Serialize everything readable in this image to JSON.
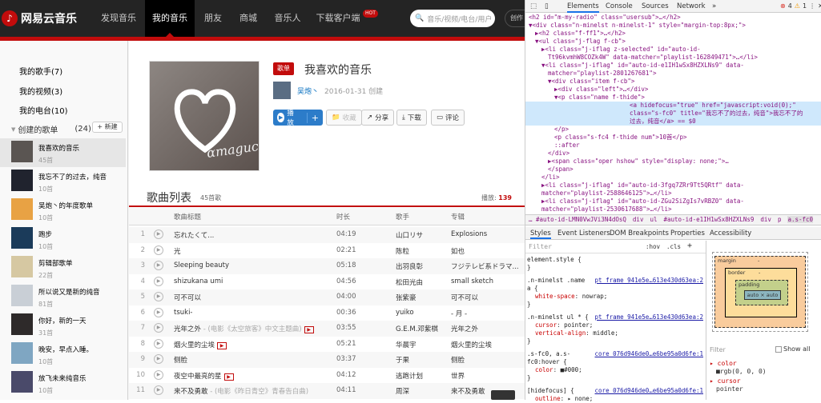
{
  "site": {
    "logo_text": "网易云音乐",
    "nav": [
      "发现音乐",
      "我的音乐",
      "朋友",
      "商城",
      "音乐人",
      "下载客户端"
    ],
    "hot_badge": "HOT",
    "search_placeholder": "音乐/视频/电台/用户",
    "creator_center": "创作"
  },
  "sidebar": {
    "top_items": [
      "我的歌手(7)",
      "我的视频(3)",
      "我的电台(10)"
    ],
    "created_label": "创建的歌单",
    "created_count": "(24)",
    "new_button": "+ 新建",
    "playlists": [
      {
        "name": "我喜欢的音乐",
        "count": "45首"
      },
      {
        "name": "我忘不了的过去，纯音",
        "count": "10首"
      },
      {
        "name": "吴炮丶的年度歌单",
        "count": "10首"
      },
      {
        "name": "跑步",
        "count": "10首"
      },
      {
        "name": "剪辑部歌单",
        "count": "22首"
      },
      {
        "name": "所以说又是新的纯音",
        "count": "81首"
      },
      {
        "name": "你好，新的一天",
        "count": "31首"
      },
      {
        "name": "晚安，早点入睡。",
        "count": "10首"
      },
      {
        "name": "放飞未来纯音乐",
        "count": "10首"
      }
    ]
  },
  "playlist": {
    "badge": "歌单",
    "title": "我喜欢的音乐",
    "creator": "吴炮丶",
    "created": "2016-01-31 创建",
    "buttons": {
      "play": "播放",
      "collect": "收藏",
      "share": "分享",
      "download": "下载",
      "comment": "评论"
    },
    "list_title": "歌曲列表",
    "list_count": "45首歌",
    "play_count_label": "播放:",
    "play_count": "139",
    "columns": [
      "歌曲标题",
      "时长",
      "歌手",
      "专辑"
    ],
    "songs": [
      {
        "no": "1",
        "title": "忘れたくて...",
        "alias": "",
        "mv": false,
        "duration": "04:19",
        "singer": "山口リサ",
        "album": "Explosions"
      },
      {
        "no": "2",
        "title": "光",
        "alias": "",
        "mv": false,
        "duration": "02:21",
        "singer": "陈粒",
        "album": "如也"
      },
      {
        "no": "3",
        "title": "Sleeping beauty",
        "alias": "",
        "mv": false,
        "duration": "05:18",
        "singer": "出羽良彰",
        "album": "フジテレビ系ドラマ..."
      },
      {
        "no": "4",
        "title": "shizukana umi",
        "alias": "",
        "mv": false,
        "duration": "04:56",
        "singer": "松田光由",
        "album": "small sketch"
      },
      {
        "no": "5",
        "title": "可不可以",
        "alias": "",
        "mv": false,
        "duration": "04:00",
        "singer": "张紫豪",
        "album": "可不可以"
      },
      {
        "no": "6",
        "title": "tsuki-",
        "alias": "",
        "mv": false,
        "duration": "00:36",
        "singer": "yuiko",
        "album": "- 月 -"
      },
      {
        "no": "7",
        "title": "光年之外",
        "alias": " - (电影《太空旅客》中文主题曲)",
        "mv": true,
        "duration": "03:55",
        "singer": "G.E.M.邓紫棋",
        "album": "光年之外"
      },
      {
        "no": "8",
        "title": "烟火里的尘埃",
        "alias": "",
        "mv": true,
        "duration": "05:21",
        "singer": "华晨宇",
        "album": "烟火里的尘埃"
      },
      {
        "no": "9",
        "title": "侧脸",
        "alias": "",
        "mv": false,
        "duration": "03:37",
        "singer": "于果",
        "album": "侧脸"
      },
      {
        "no": "10",
        "title": "夜空中最亮的星",
        "alias": "",
        "mv": true,
        "duration": "04:12",
        "singer": "逃跑计划",
        "album": "世界"
      },
      {
        "no": "11",
        "title": "来不及勇敢",
        "alias": " - (电影《昨日青空》青春告白曲)",
        "mv": false,
        "duration": "04:11",
        "singer": "周深",
        "album": "来不及勇敢"
      }
    ]
  },
  "devtools": {
    "tabs": [
      "Elements",
      "Console",
      "Sources",
      "Network"
    ],
    "errors": "4",
    "warnings": "1",
    "dom_lines": [
      {
        "indent": 0,
        "text": "<h2 id=\"m-my-radio\" class=\"usersub\">…</h2>"
      },
      {
        "indent": 0,
        "text": "▼<div class=\"n-minelst n-minelst-1\" style=\"margin-top:8px;\">"
      },
      {
        "indent": 1,
        "text": "▶<h2 class=\"f-ff1\">…</h2>"
      },
      {
        "indent": 1,
        "text": "▼<ul class=\"j-flag f-cb\">"
      },
      {
        "indent": 2,
        "text": "▶<li class=\"j-iflag z-selected\" id=\"auto-id-"
      },
      {
        "indent": 3,
        "text": "Tt96kvmhW8COZk4W\" data-matcher=\"playlist-162849471\">…</li>"
      },
      {
        "indent": 2,
        "text": "▼<li class=\"j-iflag\" id=\"auto-id-e1IH1wSx8HZXLNs9\" data-"
      },
      {
        "indent": 3,
        "text": "matcher=\"playlist-2801267681\">"
      },
      {
        "indent": 3,
        "text": "▼<div class=\"item f-cb\">"
      },
      {
        "indent": 4,
        "text": "▶<div class=\"left\">…</div>"
      },
      {
        "indent": 4,
        "text": "▼<p class=\"name f-thide\">"
      },
      {
        "indent": 5,
        "text": "<a hidefocus=\"true\" href=\"javascript:void(0);\""
      },
      {
        "indent": 5,
        "text": "class=\"s-fc0\" title=\"我忘不了的过去，纯音\">我忘不了的"
      },
      {
        "indent": 5,
        "text": "过去，纯音</a> == $0"
      },
      {
        "indent": 4,
        "text": "</p>"
      },
      {
        "indent": 4,
        "text": "<p class=\"s-fc4 f-thide num\">10首</p>"
      },
      {
        "indent": 4,
        "text": "::after"
      },
      {
        "indent": 3,
        "text": "</div>"
      },
      {
        "indent": 3,
        "text": "▶<span class=\"oper hshow\" style=\"display: none;\">…"
      },
      {
        "indent": 3,
        "text": "</span>"
      },
      {
        "indent": 2,
        "text": "</li>"
      },
      {
        "indent": 2,
        "text": "▶<li class=\"j-iflag\" id=\"auto-id-3fgq7ZRr9Tt5QRtf\" data-"
      },
      {
        "indent": 2,
        "text": "matcher=\"playlist-2588646125\">…</li>"
      },
      {
        "indent": 2,
        "text": "▶<li class=\"j-iflag\" id=\"auto-id-ZGu2SiZgIs7vRBZ0\" data-"
      },
      {
        "indent": 2,
        "text": "matcher=\"playlist-2530617688\">…</li>"
      }
    ],
    "crumbs": [
      "… #auto-id-LMN0VwJVi3N4dOsQ",
      "div",
      "ul",
      "#auto-id-e1IH1wSx8HZXLNs9",
      "div",
      "p",
      "a.s-fc0"
    ],
    "sub_tabs": [
      "Styles",
      "Event Listeners",
      "DOM Breakpoints",
      "Properties",
      "Accessibility"
    ],
    "filter_placeholder": "Filter",
    "hov": ":hov",
    "cls": ".cls",
    "rules": [
      {
        "sel": "element.style {",
        "src": "",
        "props": [],
        "close": "}"
      },
      {
        "sel": ".n-minelst .name",
        "src": "pt_frame_941e5e…613e430d63ea:2",
        "sel2": "a {",
        "props": [
          {
            "k": "white-space",
            "v": "nowrap;"
          }
        ],
        "close": "}"
      },
      {
        "sel": ".n-minelst ul * {",
        "src": "pt_frame_941e5e…613e430d63ea:2",
        "props": [
          {
            "k": "cursor",
            "v": "pointer;"
          },
          {
            "k": "vertical-align",
            "v": "middle;"
          }
        ],
        "close": "}"
      },
      {
        "sel": ".s-fc0, a.s-",
        "src": "core_076d946de0…e6be95a0d6fe:1",
        "sel2": "fc0:hover {",
        "props": [
          {
            "k": "color",
            "v": "■#000;"
          }
        ],
        "close": "}"
      },
      {
        "sel": "[hidefocus] {",
        "src": "core_076d946de0…e6be95a0d6fe:1",
        "props": [
          {
            "k": "outline",
            "v": "▸ none;"
          }
        ],
        "close": ""
      }
    ],
    "box": {
      "margin": "margin",
      "border": "border",
      "padding": "padding",
      "content": "auto × auto",
      "dash": "-"
    },
    "computed_filter": "Filter",
    "show_all": "Show all",
    "computed": [
      {
        "k": "▸ color",
        "v": "■rgb(0, 0, 0)"
      },
      {
        "k": "▸ cursor",
        "v": "pointer"
      }
    ]
  }
}
